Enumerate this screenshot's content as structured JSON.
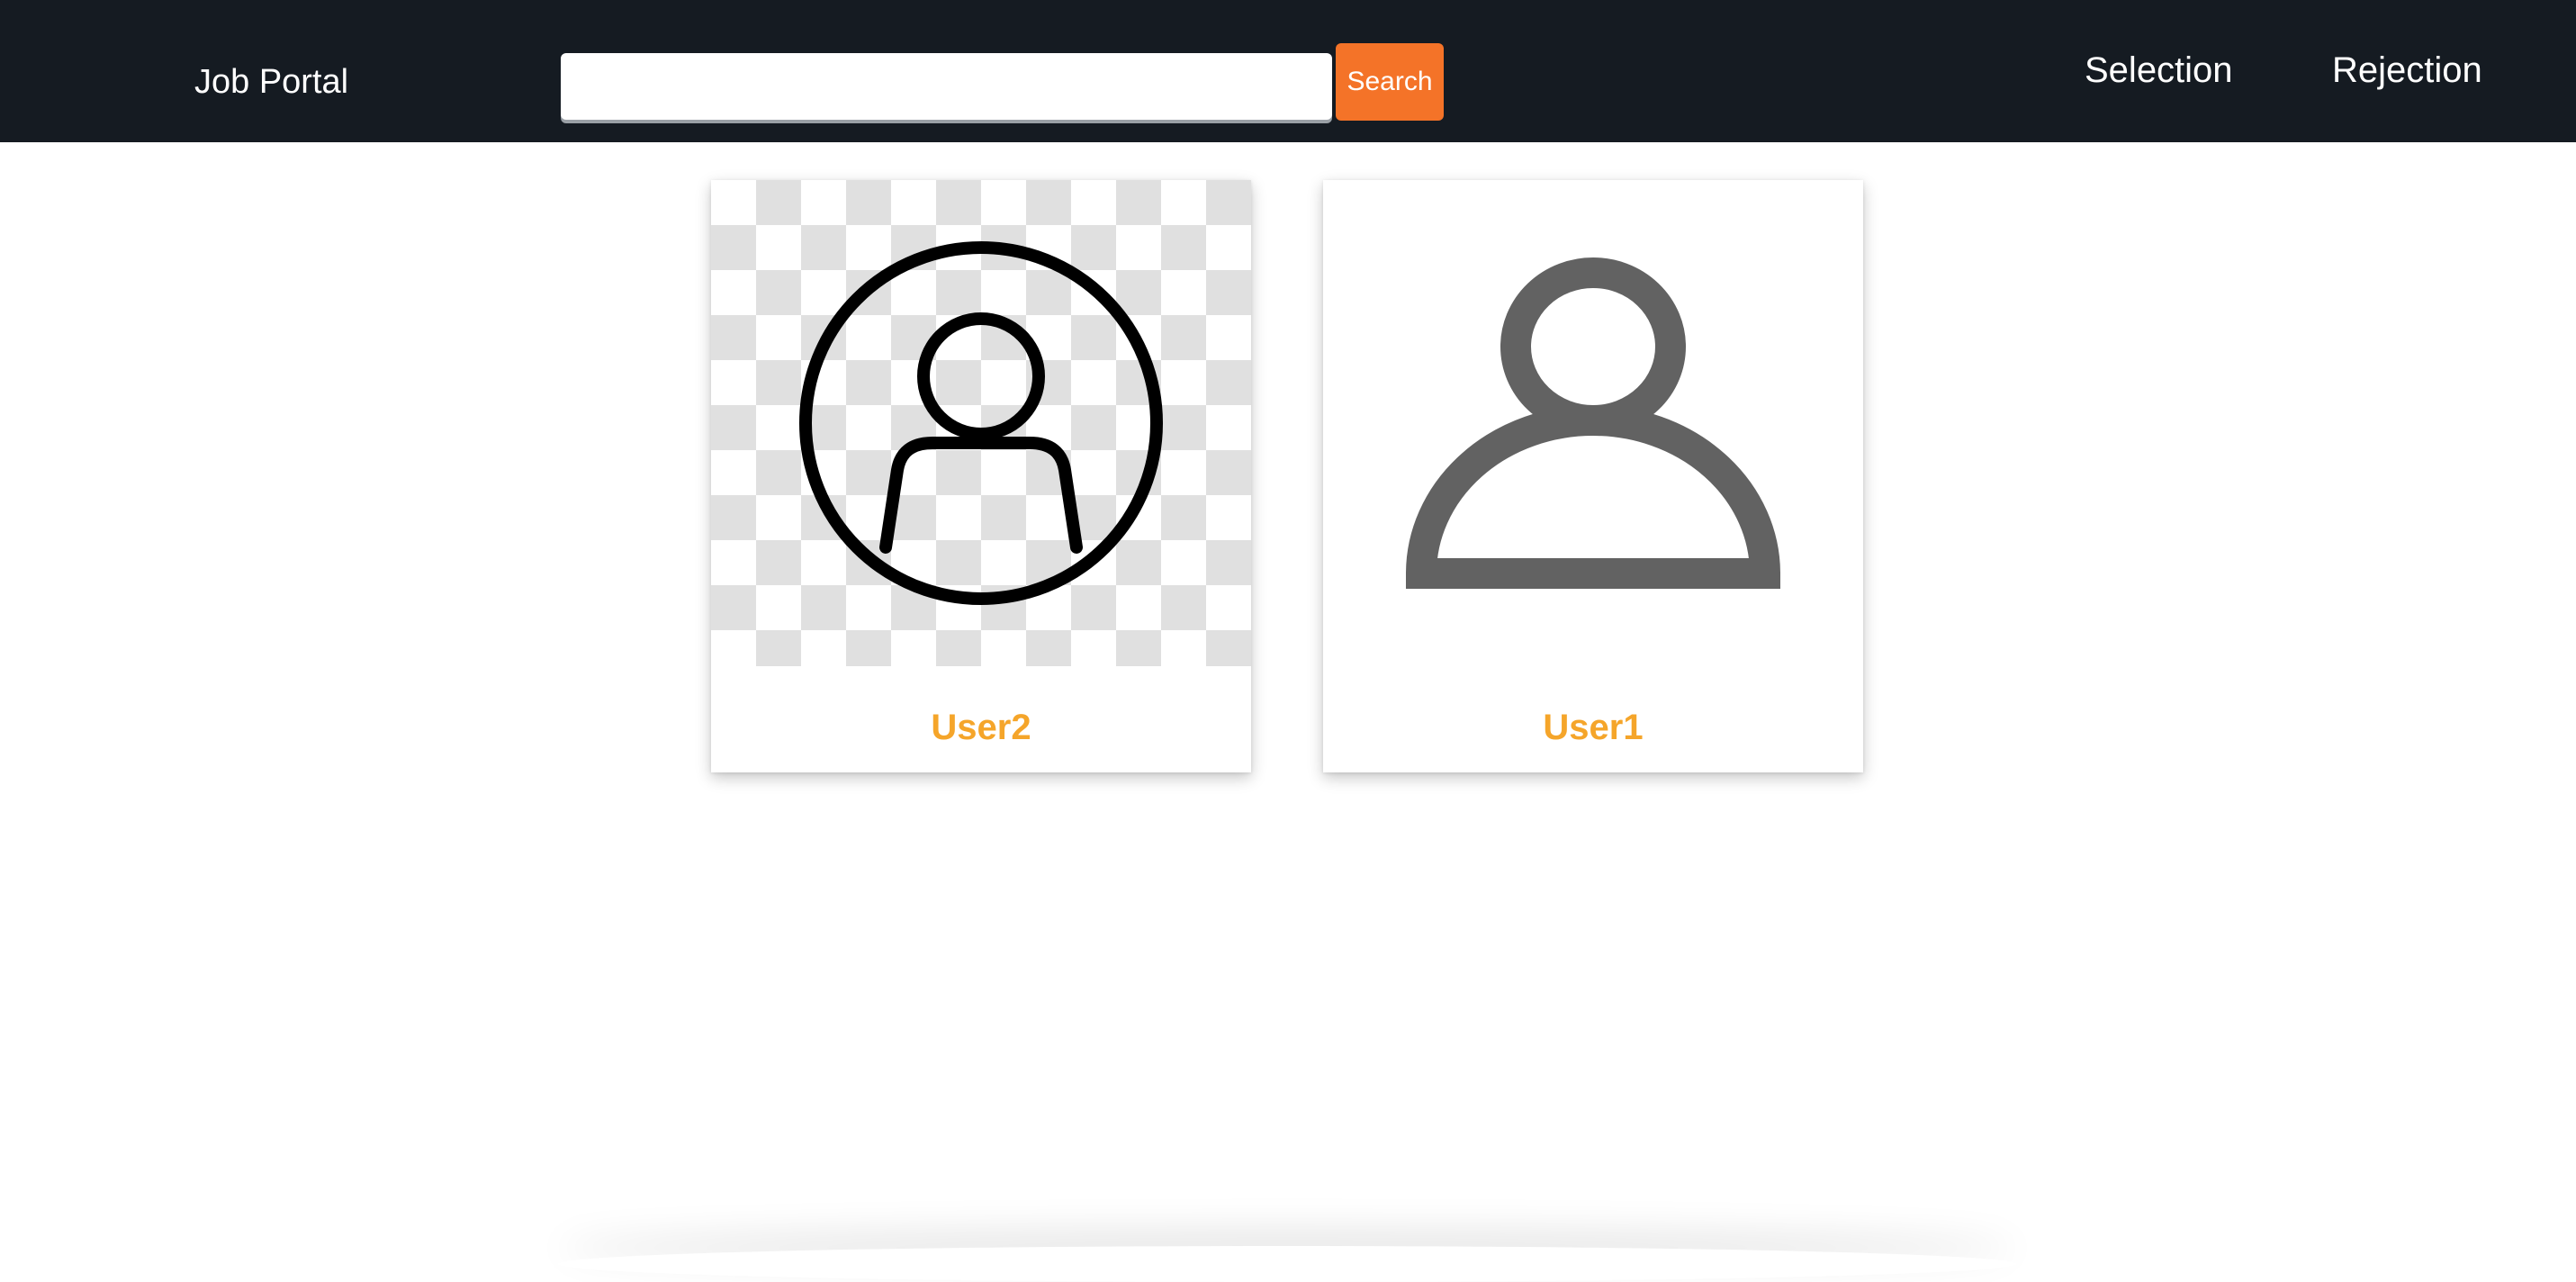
{
  "header": {
    "brand": "Job Portal",
    "search": {
      "value": "",
      "placeholder": "",
      "button_label": "Search"
    },
    "nav": {
      "selection": "Selection",
      "rejection": "Rejection"
    }
  },
  "cards": [
    {
      "name": "User2",
      "icon": "user-circle-outline-icon"
    },
    {
      "name": "User1",
      "icon": "user-silhouette-icon"
    }
  ],
  "colors": {
    "header_bg": "#151b22",
    "accent": "#f47328",
    "name": "#f5a52a",
    "icon_gray": "#626262"
  }
}
